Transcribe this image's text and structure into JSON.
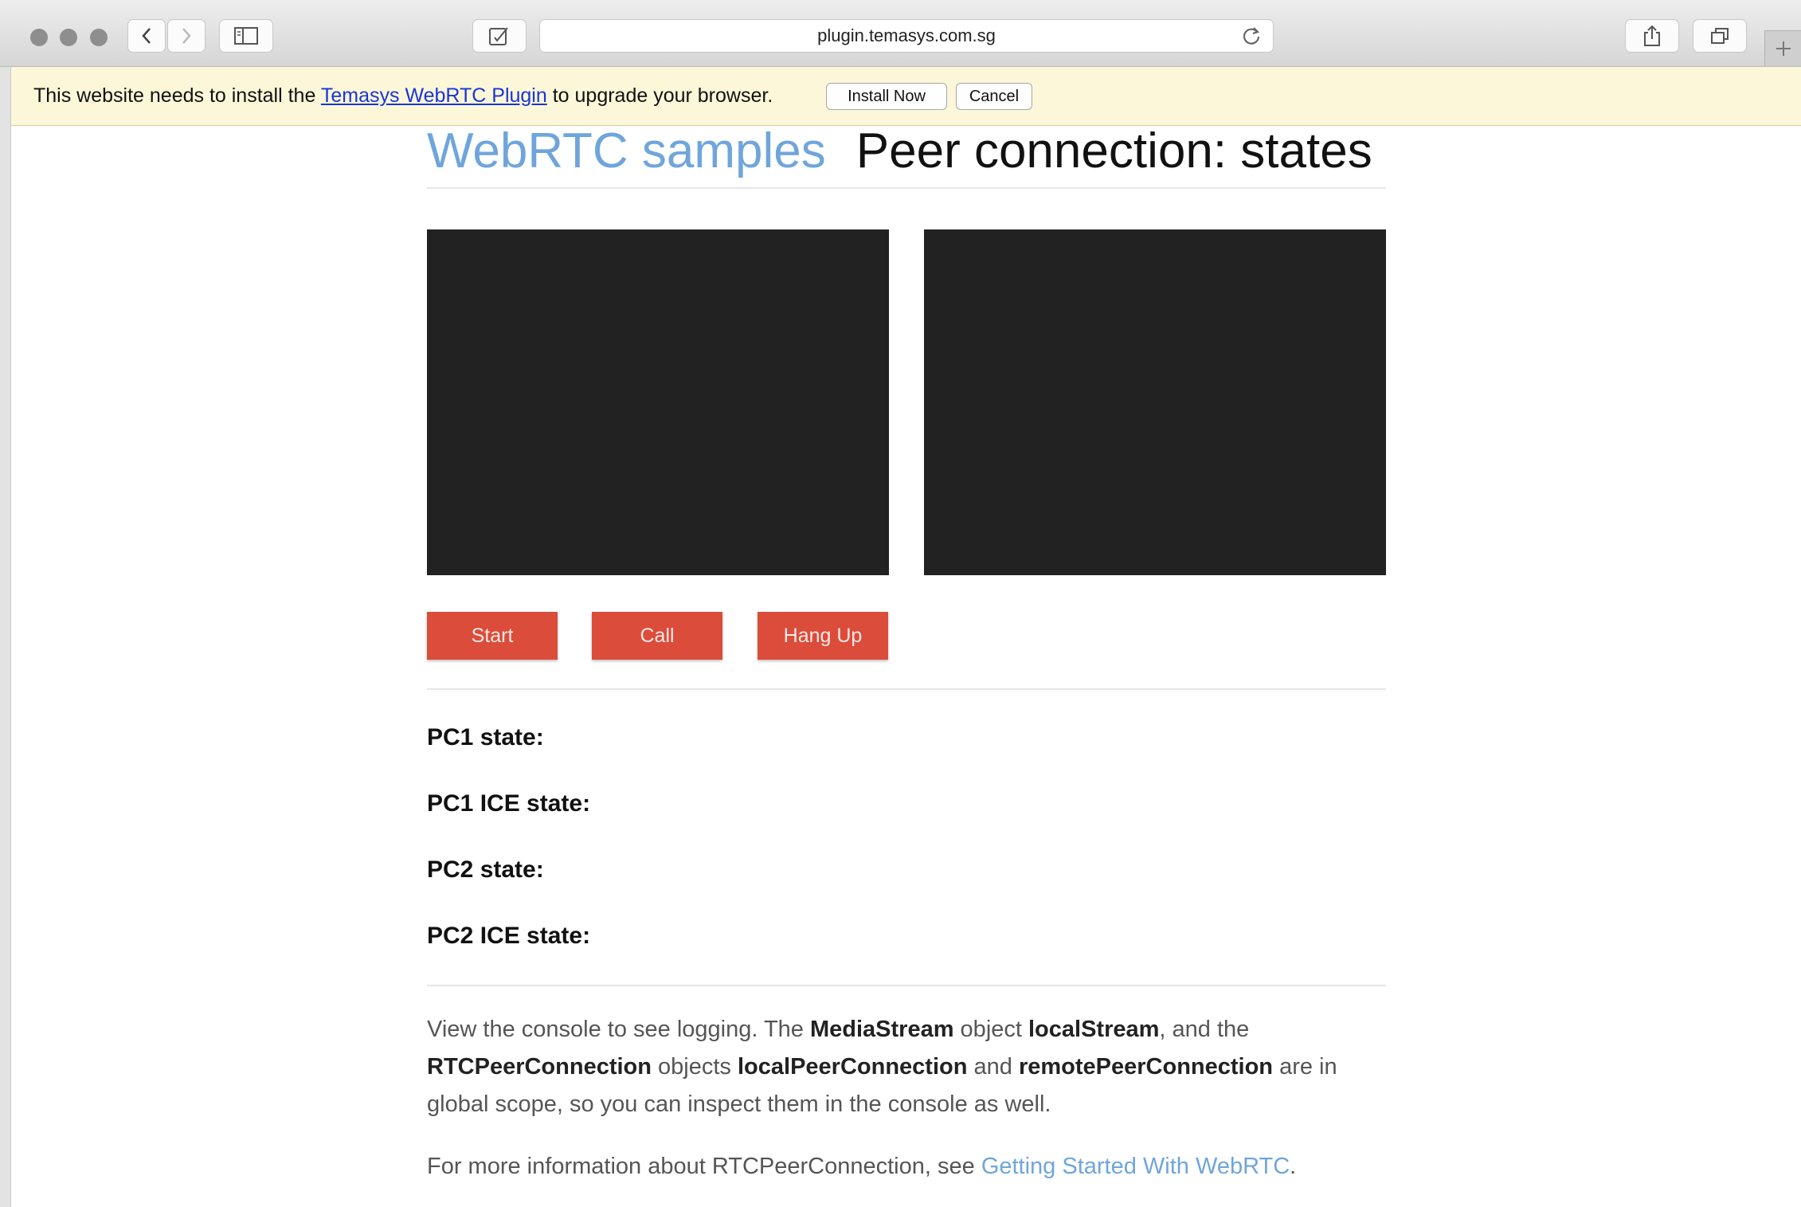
{
  "browser": {
    "url": "plugin.temasys.com.sg",
    "icons": [
      "close-light",
      "minimize-light",
      "zoom-light",
      "back-icon",
      "forward-icon",
      "sidebar-icon",
      "edit-icon",
      "reload-icon",
      "share-icon",
      "tabs-icon",
      "plus-icon"
    ]
  },
  "notification": {
    "text_before": "This website needs to install the ",
    "link_text": "Temasys WebRTC Plugin",
    "text_after": " to upgrade your browser.",
    "install_label": "Install Now",
    "cancel_label": "Cancel",
    "background_color": "#fcf7d8"
  },
  "page": {
    "brand": "WebRTC samples",
    "title": "Peer connection: states",
    "buttons": {
      "start": "Start",
      "call": "Call",
      "hangup": "Hang Up"
    },
    "states": [
      "PC1 state:",
      "PC1 ICE state:",
      "PC2 state:",
      "PC2 ICE state:"
    ],
    "para1": {
      "t1": "View the console to see logging. The ",
      "b1": "MediaStream",
      "t2": " object ",
      "b2": "localStream",
      "t3": ", and the ",
      "b3": "RTCPeerConnection",
      "t4": " objects ",
      "b4": "localPeerConnection",
      "t5": " and ",
      "b5": "remotePeerConnection",
      "t6": " are in global scope, so you can inspect them in the console as well."
    },
    "para2": {
      "text": "For more information about RTCPeerConnection, see ",
      "link": "Getting Started With WebRTC",
      "end": "."
    },
    "colors": {
      "brand": "#6fa5dc",
      "button": "#db4c3a",
      "video": "#222222"
    }
  }
}
